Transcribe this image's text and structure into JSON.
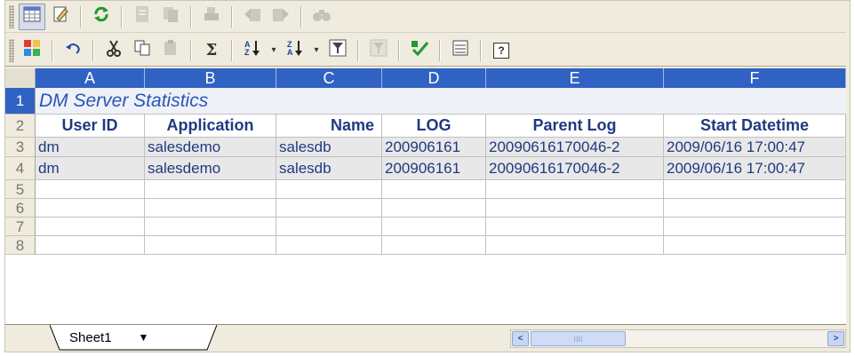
{
  "toolbar_top": {
    "buttons": [
      "grid-view-icon",
      "edit-icon",
      "refresh-icon",
      "form-icon",
      "copy-doc-icon",
      "print-icon",
      "import-icon",
      "export-icon",
      "find-icon"
    ]
  },
  "toolbar_bottom": {
    "buttons": [
      "colorize-icon",
      "undo-icon",
      "cut-icon",
      "copy-icon",
      "paste-icon",
      "sum-icon",
      "sort-ascending-icon",
      "sort-descending-icon",
      "filter-icon",
      "filter-clear-icon",
      "check-icon",
      "export-sheet-icon",
      "help-icon"
    ],
    "sum_glyph": "Σ",
    "help_glyph": "?"
  },
  "columns": [
    "A",
    "B",
    "C",
    "D",
    "E",
    "F"
  ],
  "row_numbers": [
    "1",
    "2",
    "3",
    "4",
    "5",
    "6",
    "7",
    "8"
  ],
  "sheet": {
    "title": "DM Server Statistics",
    "headers": [
      "User ID",
      "Application",
      "Name",
      "LOG",
      "Parent Log",
      "Start Datetime"
    ],
    "rows": [
      [
        "dm",
        "salesdemo",
        "salesdb",
        "200906161",
        "20090616170046-2",
        "2009/06/16 17:00:47"
      ],
      [
        "dm",
        "salesdemo",
        "salesdb",
        "200906161",
        "20090616170046-2",
        "2009/06/16 17:00:47"
      ]
    ]
  },
  "tabs": {
    "sheet1": "Sheet1",
    "dropdown_arrow": "▼"
  },
  "scrollbar": {
    "left": "<",
    "right": ">",
    "grip": "IIII"
  },
  "colors": {
    "header_blue": "#2f62c3",
    "title_text": "#2b55b8",
    "cell_text": "#203a80"
  }
}
